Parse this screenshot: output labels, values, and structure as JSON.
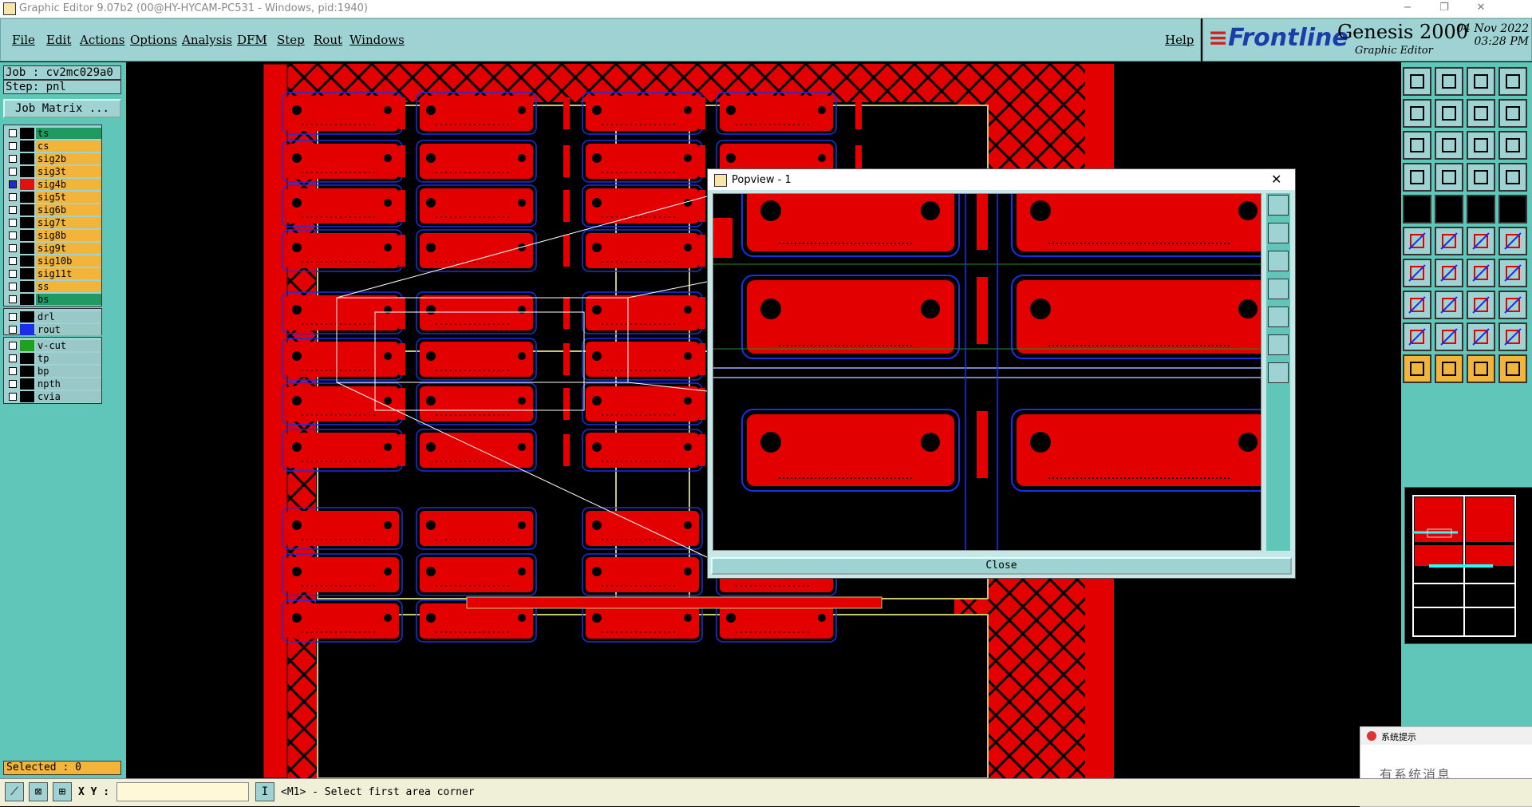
{
  "window": {
    "title": "Graphic Editor 9.07b2 (00@HY-HYCAM-PC531 - Windows, pid:1940)",
    "min": "−",
    "restore": "❐",
    "close": "✕"
  },
  "menu": {
    "items": [
      "File",
      "Edit",
      "Actions",
      "Options",
      "Analysis",
      "DFM",
      "Step",
      "Rout",
      "Windows"
    ],
    "help": "Help"
  },
  "brand": {
    "logo_prefix": "≡",
    "logo": "Frontline",
    "product": "Genesis 2000",
    "subtitle": "Graphic Editor",
    "date": "04 Nov 2022",
    "time": "03:28 PM"
  },
  "job": {
    "job_label": "Job : cv2mc029a0",
    "step_label": "Step: pnl",
    "matrix_button": "Job Matrix ..."
  },
  "layers": {
    "signal": [
      {
        "name": "ts",
        "color": "#1f9a63",
        "active": false
      },
      {
        "name": "cs",
        "color": "#f2b53a",
        "active": false
      },
      {
        "name": "sig2b",
        "color": "#f2b53a",
        "active": false
      },
      {
        "name": "sig3t",
        "color": "#f2b53a",
        "active": false
      },
      {
        "name": "sig4b",
        "color": "#f2b53a",
        "active": true,
        "swatch": "#e31010"
      },
      {
        "name": "sig5t",
        "color": "#f2b53a",
        "active": false
      },
      {
        "name": "sig6b",
        "color": "#f2b53a",
        "active": false
      },
      {
        "name": "sig7t",
        "color": "#f2b53a",
        "active": false
      },
      {
        "name": "sig8b",
        "color": "#f2b53a",
        "active": false
      },
      {
        "name": "sig9t",
        "color": "#f2b53a",
        "active": false
      },
      {
        "name": "sig10b",
        "color": "#f2b53a",
        "active": false
      },
      {
        "name": "sig11t",
        "color": "#f2b53a",
        "active": false
      },
      {
        "name": "ss",
        "color": "#f2b53a",
        "active": false
      },
      {
        "name": "bs",
        "color": "#1f9a63",
        "active": false
      }
    ],
    "drill": [
      {
        "name": "drl",
        "color": "#9ac8c8",
        "active": false
      },
      {
        "name": "rout",
        "color": "#9ac8c8",
        "active": false,
        "swatch": "#1a30e8"
      }
    ],
    "misc": [
      {
        "name": "v-cut",
        "color": "#9ac8c8",
        "active": false,
        "swatch": "#1fa020"
      },
      {
        "name": "tp",
        "color": "#9ac8c8",
        "active": false
      },
      {
        "name": "bp",
        "color": "#9ac8c8",
        "active": false
      },
      {
        "name": "npth",
        "color": "#9ac8c8",
        "active": false
      },
      {
        "name": "cvia",
        "color": "#9ac8c8",
        "active": false
      }
    ]
  },
  "status": {
    "selected": "Selected : 0"
  },
  "bottom": {
    "xy_label": "X Y :",
    "xy_value": "",
    "prompt": "<M1> - Select first area corner",
    "prompt_btn": "I"
  },
  "popview": {
    "title": "Popview - 1",
    "close_x": "✕",
    "close_button": "Close"
  },
  "sysnote": {
    "title": "系统提示",
    "body": "有系统消息"
  },
  "colors": {
    "copper": "#e30000",
    "outline": "#1a30e8",
    "panel_teal": "#9fd3d3",
    "frame_teal": "#5fc6b9",
    "layer_orange": "#f2b53a"
  }
}
